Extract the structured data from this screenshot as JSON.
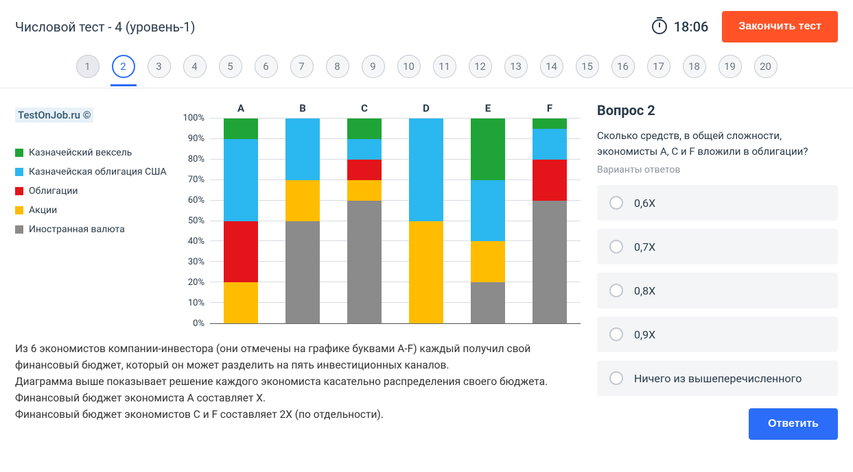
{
  "header": {
    "title": "Числовой тест - 4 (уровень-1)",
    "timer": "18:06",
    "finish_label": "Закончить тест"
  },
  "nav": {
    "items": [
      "1",
      "2",
      "3",
      "4",
      "5",
      "6",
      "7",
      "8",
      "9",
      "10",
      "11",
      "12",
      "13",
      "14",
      "15",
      "16",
      "17",
      "18",
      "19",
      "20"
    ],
    "active_index": 1
  },
  "watermark": "TestOnJob.ru ©",
  "legend": [
    {
      "label": "Казначейский вексель",
      "color": "#1fa437"
    },
    {
      "label": "Казначейская облигация США",
      "color": "#2bb7ef"
    },
    {
      "label": "Облигации",
      "color": "#e3151a"
    },
    {
      "label": "Акции",
      "color": "#ffbc00"
    },
    {
      "label": "Иностранная валюта",
      "color": "#8b8b8b"
    }
  ],
  "chart_data": {
    "type": "bar",
    "stacked": true,
    "categories": [
      "A",
      "B",
      "C",
      "D",
      "E",
      "F"
    ],
    "series": [
      {
        "name": "Иностранная валюта",
        "color": "#8b8b8b",
        "values": [
          0,
          50,
          60,
          0,
          20,
          60
        ]
      },
      {
        "name": "Акции",
        "color": "#ffbc00",
        "values": [
          20,
          20,
          10,
          50,
          20,
          0
        ]
      },
      {
        "name": "Облигации",
        "color": "#e3151a",
        "values": [
          30,
          0,
          10,
          0,
          0,
          20
        ]
      },
      {
        "name": "Казначейская облигация США",
        "color": "#2bb7ef",
        "values": [
          40,
          30,
          10,
          50,
          30,
          15
        ]
      },
      {
        "name": "Казначейский вексель",
        "color": "#1fa437",
        "values": [
          10,
          0,
          10,
          0,
          30,
          5
        ]
      }
    ],
    "ylabel": "",
    "xlabel": "",
    "ylim": [
      0,
      100
    ],
    "yticks": [
      "100%",
      "90%",
      "80%",
      "70%",
      "60%",
      "50%",
      "40%",
      "30%",
      "20%",
      "10%",
      "0%"
    ]
  },
  "description": "Из 6 экономистов компании-инвестора (они отмечены на графике буквами A-F) каждый получил свой финансовый бюджет, который он может разделить на пять инвестиционных каналов.\nДиаграмма выше показывает решение каждого экономиста касательно распределения своего бюджета.\nФинансовый бюджет экономиста А составляет X.\nФинансовый бюджет экономистов С и F составляет 2X  (по отдельности).",
  "question": {
    "title": "Вопрос 2",
    "text": "Сколько средств, в общей сложности, экономисты А, С и F вложили в облигации?",
    "hint": "Варианты ответов",
    "options": [
      "0,6X",
      "0,7X",
      "0,8X",
      "0,9X",
      "Ничего из вышеперечисленного"
    ],
    "answer_label": "Ответить"
  }
}
